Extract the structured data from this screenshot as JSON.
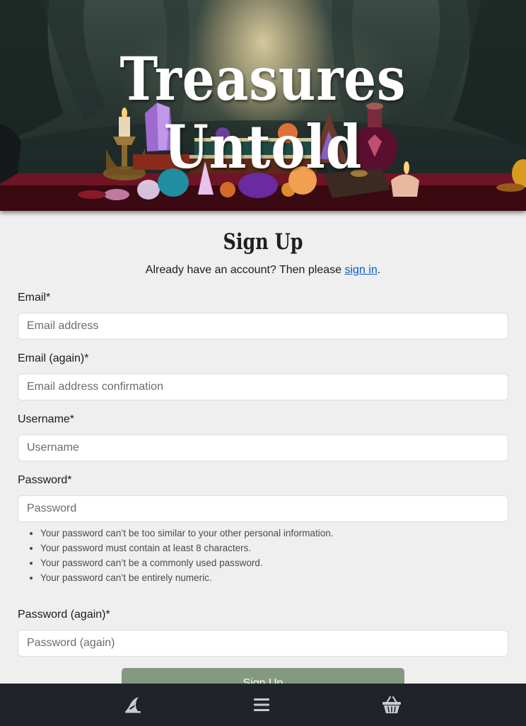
{
  "brand": {
    "title": "Treasures Untold"
  },
  "signup": {
    "heading": "Sign Up",
    "signin_prefix": "Already have an account? Then please ",
    "signin_link": "sign in",
    "signin_suffix": ".",
    "fields": [
      {
        "label": "Email*",
        "placeholder": "Email address"
      },
      {
        "label": "Email (again)*",
        "placeholder": "Email address confirmation"
      },
      {
        "label": "Username*",
        "placeholder": "Username"
      },
      {
        "label": "Password*",
        "placeholder": "Password"
      },
      {
        "label": "Password (again)*",
        "placeholder": "Password (again)"
      }
    ],
    "password_help": [
      "Your password can’t be too similar to your other personal information.",
      "Your password must contain at least 8 characters.",
      "Your password can’t be a commonly used password.",
      "Your password can’t be entirely numeric."
    ],
    "submit_label": "Sign Up"
  },
  "bottom_nav": {
    "items": [
      {
        "icon": "wizard-hat-icon"
      },
      {
        "icon": "menu-icon"
      },
      {
        "icon": "basket-icon"
      }
    ]
  },
  "colors": {
    "page_background": "#efefef",
    "link": "#0a58ca",
    "button": "#849a80",
    "nav_background": "#202429",
    "nav_icon": "#c8cbd0"
  }
}
